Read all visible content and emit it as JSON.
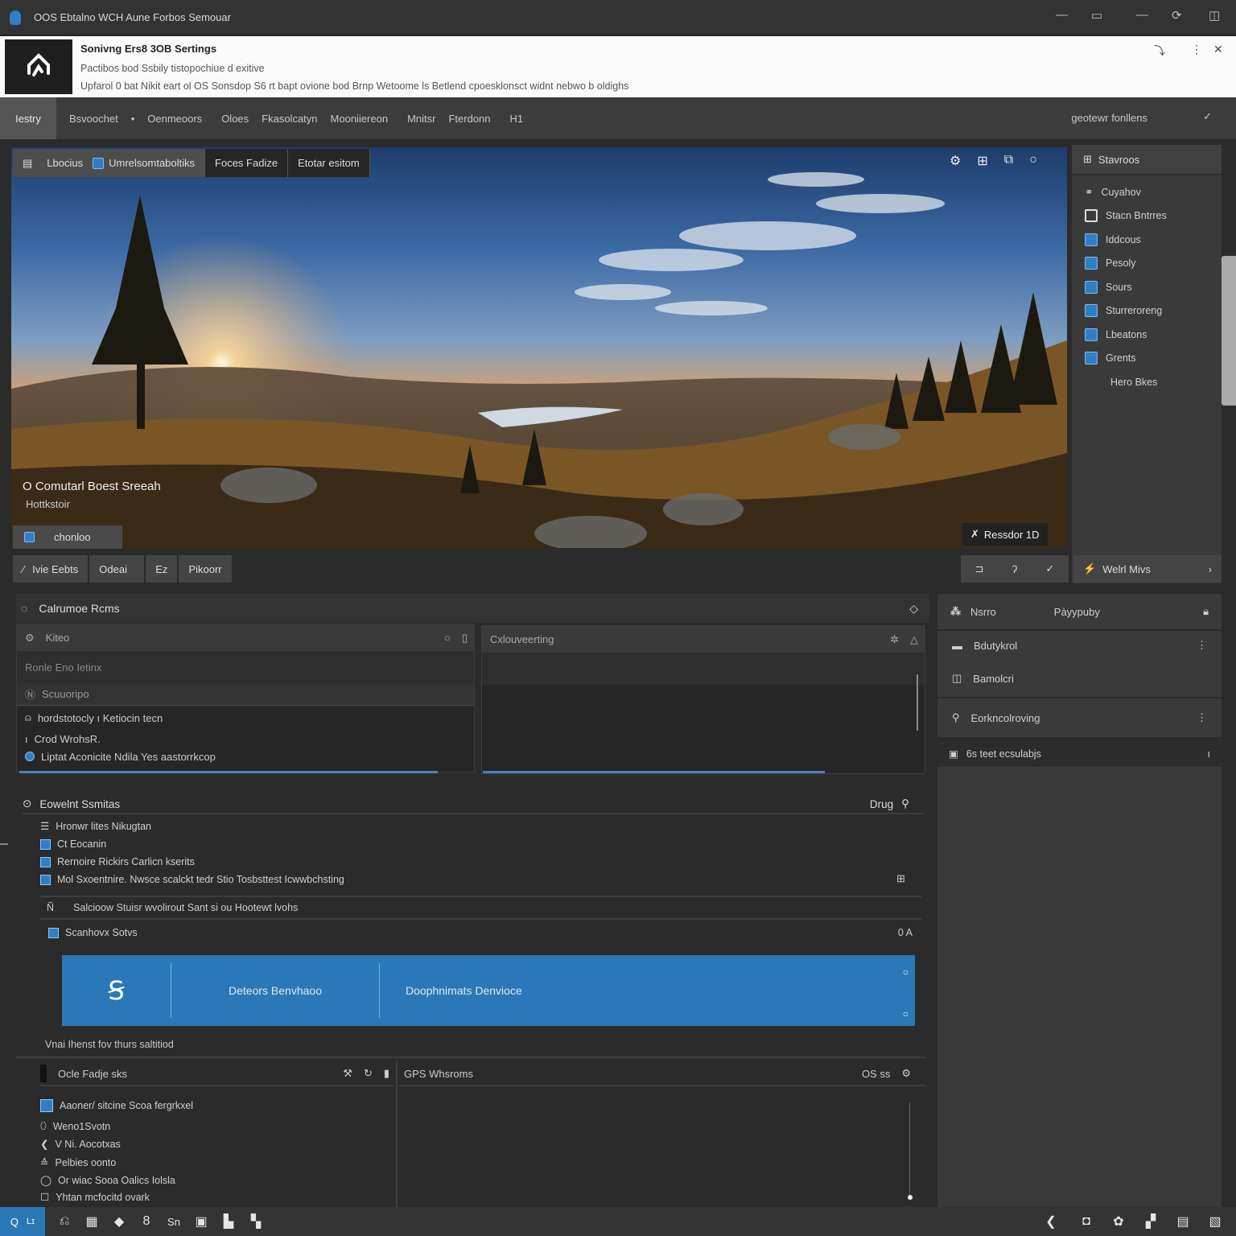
{
  "window": {
    "title": "OOS Ebtalno  WCH Aune Forbos  Semouar",
    "controls": [
      "minimize",
      "maximize",
      "minimize-alt",
      "sync",
      "close"
    ]
  },
  "banner": {
    "heading": "Sonivng Ers8 3OB Sertings",
    "line2": "Pactibos bod Ssbily tistopochiue d exitive",
    "line3": "Upfarol 0 bat Nikit eart ol OS Sonsdop S6 rt bapt ovione bod Brnp Wetoome ls Betlend cpoesklonsct widnt nebwo b oldighs"
  },
  "menubar": {
    "items": [
      "Iestry",
      "Bsvoochet",
      "•",
      "Oenmeoors",
      "Oloes",
      "Fkasolcatyn",
      "Mooniiereon",
      "Mnitsr",
      "Fterdonn",
      "H1"
    ],
    "right_label": "geotewr fonllens"
  },
  "image_panel": {
    "tabs": [
      "Lbocius",
      "Umrelsomtaboltiks",
      "Foces Fadize",
      "Etotar esitom"
    ],
    "caption_title": "O Comutarl Boest Sreeah",
    "caption_sub": "Hottkstoir",
    "chip_label": "chonloo",
    "resolution_label": "Ressdor 1D",
    "actions": [
      "Ivie Eebts",
      "Odeai",
      "Ez",
      "Pikoorr"
    ]
  },
  "side_panel": {
    "header": "Stavroos",
    "items": [
      "Cuyahov",
      "Stacn Bntrres",
      "Iddcous",
      "Pesoly",
      "Sours",
      "Sturreroreng",
      "Lbeatons",
      "Grents",
      "Hero Bkes"
    ],
    "footer": "Welrl Mivs"
  },
  "left_panel": {
    "header": "Calrumoe Rcms",
    "box1": {
      "header": "Kiteo",
      "rows": [
        "Ronle Eno Ietinx",
        "Scuuoripo",
        "hordstotocly ı Ketiocin tecn",
        "Crod WrohsR.",
        "Liptat Aconicite Ndila Yes aastorrkcop"
      ]
    },
    "box2": {
      "header": "Cxlouveerting"
    }
  },
  "right_panel": {
    "header_left": "Nsrro",
    "header_right": "Pàyypuby",
    "items": [
      "Bdutykrol",
      "Bamolcri",
      "Eorkncolroving"
    ],
    "footer": "6s teet ecsulabjs"
  },
  "events": {
    "header": "Eowelnt Ssmitas",
    "header_right": "Drug",
    "items": [
      "Hronwr lites Nikugtan",
      "Ct Eocanin",
      "Rernoire Rickirs Carlicn kserits",
      "Mol Sxoentnire. Nwsce scalckt tedr Stio Tosbsttest Icwwbchsting"
    ],
    "sub_header": "Salcioow Stuisr wvolirout Sant si ou Hootewt lvohs",
    "sub_item": "Scanhovx Sotvs",
    "sub_item_right": "0 A",
    "card": {
      "col1": "Deteors Benvhaoo",
      "col2": "Doophnimats Denvioce"
    },
    "footnote": "Vnai Ihenst fov thurs saltitiod"
  },
  "page_size": {
    "header": "Ocle Fadje sks",
    "items": [
      "Aaoner/ sitcine Scoa fergrkxel",
      "Weno1Svotn",
      "V Ni. Aocotxas",
      "Pelbies oonto",
      "Or wiac Sooa Oalics Iolsla",
      "Yhtan mcfocitd ovark"
    ]
  },
  "gps": {
    "header": "GPS Whsroms",
    "header_right": "OS ss"
  },
  "taskbar": {
    "left_icons": [
      "search-icon",
      "ai-icon",
      "undo-icon",
      "doc-icon",
      "diamond-icon",
      "gourd-icon",
      "text-icon",
      "frame-icon",
      "file-icon",
      "map-icon"
    ],
    "right_icons": [
      "back-icon",
      "stop-icon",
      "settings-icon",
      "alert-icon",
      "list-icon",
      "chart-icon"
    ]
  },
  "colors": {
    "accent": "#2a78b8",
    "bg": "#2b2b2b",
    "banner": "#fafafa"
  }
}
